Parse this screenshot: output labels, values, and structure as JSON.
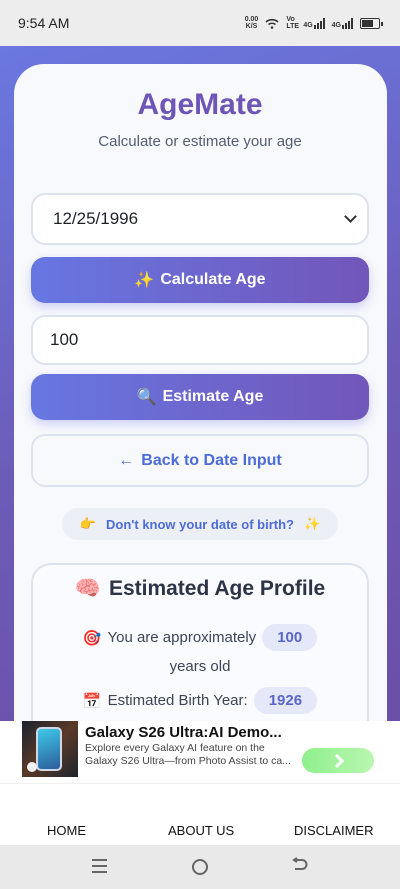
{
  "status_bar": {
    "time": "9:54 AM",
    "net_speed_value": "0.00",
    "net_speed_unit": "K/S",
    "icons": [
      "wifi-icon",
      "volte-icon",
      "signal-4g-icon",
      "signal-4g-icon",
      "battery-icon"
    ],
    "volte": "Vo LTE",
    "net1": "4G",
    "net2": "4G"
  },
  "app": {
    "title": "AgeMate",
    "subtitle": "Calculate or estimate your age",
    "date_value": "12/25/1996",
    "calculate_emoji": "✨",
    "calculate_label": "Calculate Age",
    "age_input_value": "100",
    "estimate_emoji": "🔍",
    "estimate_label": "Estimate Age",
    "back_arrow": "←",
    "back_label": "Back to Date Input",
    "hint_emoji_left": "👉",
    "hint_text": "Don't know your date of birth?",
    "hint_emoji_right": "✨"
  },
  "profile": {
    "title_emoji": "🧠",
    "title": "Estimated Age Profile",
    "approx_emoji": "🎯",
    "approx_text": "You are approximately",
    "approx_value": "100",
    "years_old": "years old",
    "birth_emoji": "📅",
    "birth_label": "Estimated Birth Year:",
    "birth_value": "1926"
  },
  "ad": {
    "title": "Galaxy S26 Ultra:AI Demo...",
    "description": "Explore every Galaxy AI feature on the Galaxy S26 Ultra—from Photo Assist to ca..."
  },
  "footer": {
    "links": [
      "HOME",
      "ABOUT US",
      "DISCLAIMER"
    ]
  },
  "colors": {
    "brand": "#6e55b8",
    "gradient_start": "#6777e2",
    "gradient_end": "#7256ba",
    "link": "#4c6cd8"
  }
}
